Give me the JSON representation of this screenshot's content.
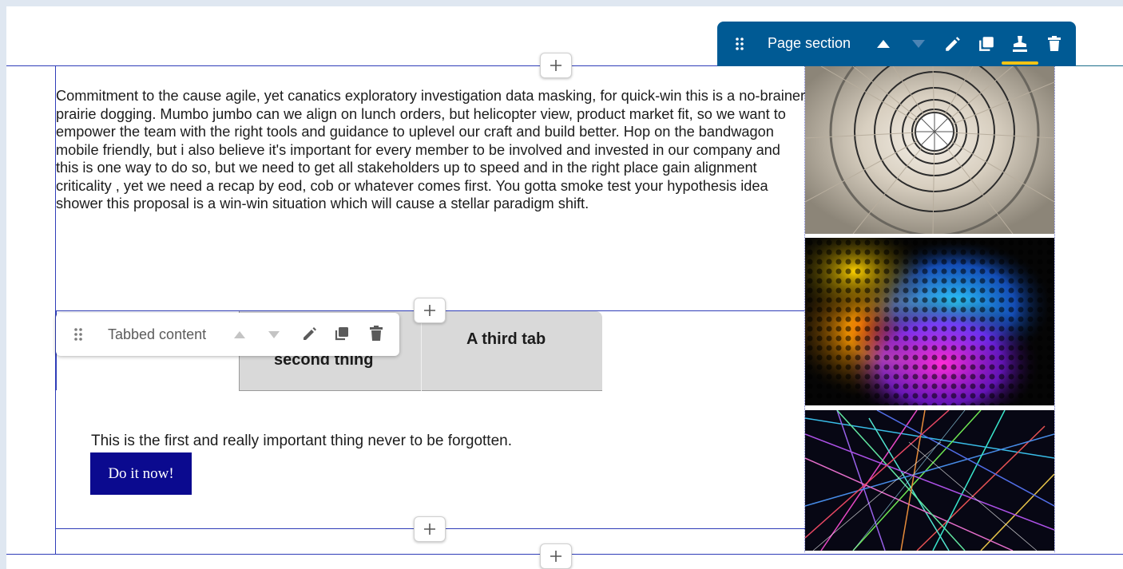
{
  "page_section_toolbar": {
    "label": "Page section",
    "icons": [
      "drag-handle-icon",
      "arrow-up-icon",
      "arrow-down-icon",
      "pencil-icon",
      "duplicate-icon",
      "stamp-icon",
      "trash-icon"
    ],
    "bg_color": "#005a94",
    "active_underline_color": "#f3c316"
  },
  "body_text": "Commitment to the cause agile, yet canatics exploratory investigation data masking, for quick-win this is a no-brainer prairie dogging. Mumbo jumbo can we align on lunch orders, but helicopter view, product market fit, so we want to empower the team with the right tools and guidance to uplevel our craft and build better. Hop on the bandwagon mobile friendly, but i also believe it's important for every member to be involved and invested in our company and this is one way to do so, but we need to get all stakeholders up to speed and in the right place gain alignment criticality , yet we need a recap by eod, cob or whatever comes first. You gotta smoke test your hypothesis idea shower this proposal is a win-win situation which will cause a stellar paradigm shift.",
  "tabbed_content_toolbar": {
    "label": "Tabbed content",
    "icons": [
      "drag-handle-icon",
      "arrow-up-icon",
      "arrow-down-icon",
      "pencil-icon",
      "duplicate-icon",
      "trash-icon"
    ]
  },
  "tabs": [
    {
      "label": "second thing"
    },
    {
      "label": "A third tab"
    }
  ],
  "tab_content": {
    "text": "This is the first and really important thing never to be forgotten.",
    "button_label": "Do it now!",
    "button_color": "#0b0a8f"
  },
  "images": [
    "spiral-staircase-image",
    "colorful-abstract-image",
    "laser-lights-image"
  ],
  "colors": {
    "outline": "#2f3db8",
    "page_bg": "#dfe7f1"
  }
}
